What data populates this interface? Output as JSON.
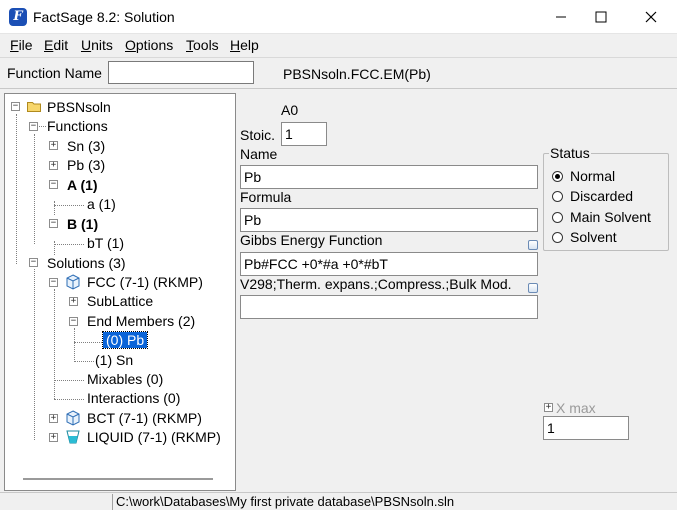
{
  "window": {
    "title": "FactSage 8.2: Solution"
  },
  "menu": {
    "items": [
      {
        "label": "File",
        "accel": "F",
        "rest": "ile"
      },
      {
        "label": "Edit",
        "accel": "E",
        "rest": "dit"
      },
      {
        "label": "Units",
        "accel": "U",
        "rest": "nits"
      },
      {
        "label": "Options",
        "accel": "O",
        "rest": "ptions"
      },
      {
        "label": "Tools",
        "accel": "T",
        "rest": "ools"
      },
      {
        "label": "Help",
        "accel": "H",
        "rest": "elp"
      }
    ]
  },
  "function_bar": {
    "label": "Function Name",
    "input_value": "",
    "current": "PBSNsoln.FCC.EM(Pb)"
  },
  "tree": {
    "root": "PBSNsoln",
    "functions": "Functions",
    "sn": "Sn (3)",
    "pb": "Pb (3)",
    "a_group": "A (1)",
    "a_item": "a (1)",
    "b_group": "B (1)",
    "b_item": "bT (1)",
    "solutions": "Solutions (3)",
    "fcc": "FCC (7-1) (RKMP)",
    "sublattice": "SubLattice",
    "end_members": "End Members (2)",
    "em0": "(0) Pb",
    "em1": "(1) Sn",
    "mixables": "Mixables (0)",
    "interactions": "Interactions (0)",
    "bct": "BCT (7-1) (RKMP)",
    "liquid": "LIQUID (7-1) (RKMP)"
  },
  "detail": {
    "a0": "A0",
    "stoic_label": "Stoic.",
    "stoic_value": "1",
    "name_label": "Name",
    "name_value": "Pb",
    "formula_label": "Formula",
    "formula_value": "Pb",
    "gibbs_label": "Gibbs Energy Function",
    "gibbs_value": "Pb#FCC +0*#a +0*#bT",
    "v298_label": "V298;Therm. expans.;Compress.;Bulk Mod.",
    "v298_value": "",
    "xmax_label": "X max",
    "xmax_value": "1"
  },
  "status": {
    "legend": "Status",
    "options": [
      "Normal",
      "Discarded",
      "Main Solvent",
      "Solvent"
    ],
    "selected": "Normal"
  },
  "statusbar": {
    "path": "C:\\work\\Databases\\My first private database\\PBSNsoln.sln"
  }
}
